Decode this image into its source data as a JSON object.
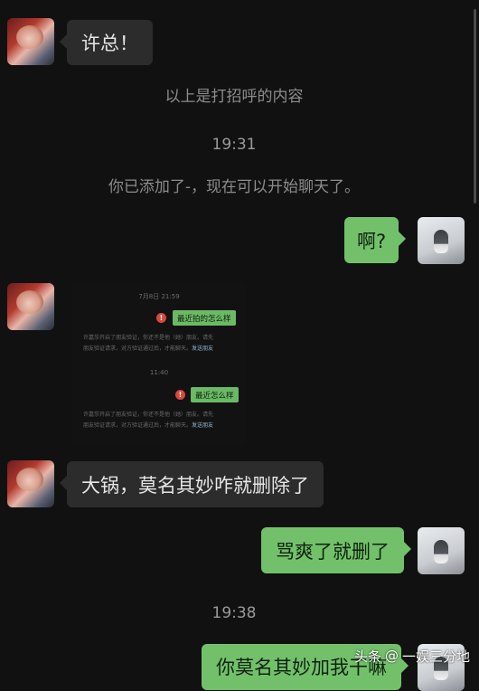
{
  "messages": {
    "m1": "许总！",
    "sys1": "以上是打招呼的内容",
    "time1": "19:31",
    "sys2": "你已添加了-，现在可以开始聊天了。",
    "m2": "啊?",
    "m3": "大锅，莫名其妙咋就删除了",
    "m4": "骂爽了就删了",
    "time2": "19:38",
    "m5": "你莫名其妙加我干嘛"
  },
  "embedded_screenshot": {
    "time_a": "7月8日 21:59",
    "bubble_a": "最近拍的怎么样",
    "warn_glyph": "!",
    "note_a_line1": "许嘉莎开启了朋友验证，你还不是他（她）朋友。请先",
    "note_a_line2_pre": "朋友验证请求，对方验证通过后，才能聊天。",
    "note_a_link": "发送朋友",
    "time_b": "11:40",
    "bubble_b": "最近怎么样",
    "note_b_line1": "许嘉莎开启了朋友验证，你还不是他（她）朋友。请先",
    "note_b_line2_pre": "朋友验证请求，对方验证通过后，才能聊天。",
    "note_b_link": "发送朋友"
  },
  "watermark": {
    "brand": "头条",
    "at": "@",
    "account": "一娱三分地"
  },
  "colors": {
    "background": "#111111",
    "self_bubble": "#72c16a",
    "other_bubble": "#2c2c2c"
  }
}
